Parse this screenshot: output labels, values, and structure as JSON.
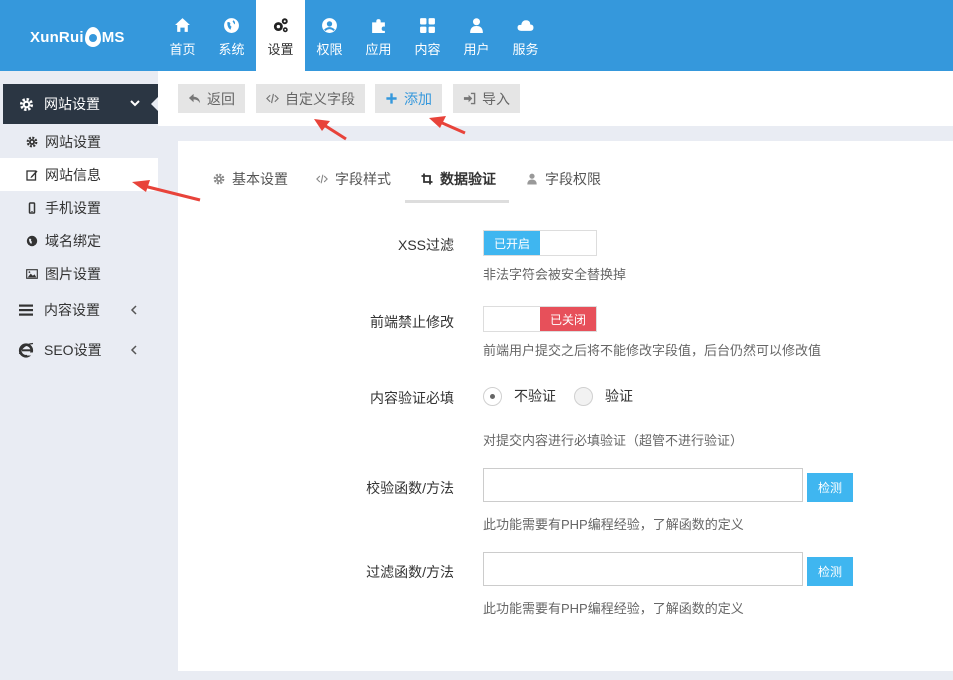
{
  "brand": {
    "logo_prefix": "XunRui",
    "logo_suffix": "MS"
  },
  "nav": {
    "items": [
      {
        "label": "首页",
        "icon": "home-icon"
      },
      {
        "label": "系统",
        "icon": "globe-icon"
      },
      {
        "label": "设置",
        "icon": "gears-icon",
        "active": true
      },
      {
        "label": "权限",
        "icon": "user-circle-icon"
      },
      {
        "label": "应用",
        "icon": "puzzle-icon"
      },
      {
        "label": "内容",
        "icon": "grid-icon"
      },
      {
        "label": "用户",
        "icon": "user-icon"
      },
      {
        "label": "服务",
        "icon": "cloud-icon"
      }
    ]
  },
  "sidebar": {
    "header": "网站设置",
    "sub_items": [
      "网站设置",
      "网站信息",
      "手机设置",
      "域名绑定",
      "图片设置"
    ],
    "groups": [
      "内容设置",
      "SEO设置"
    ]
  },
  "toolbar": {
    "back": "返回",
    "custom_field": "自定义字段",
    "add": "添加",
    "import": "导入"
  },
  "tabs": [
    "基本设置",
    "字段样式",
    "数据验证",
    "字段权限"
  ],
  "form": {
    "xss": {
      "label": "XSS过滤",
      "state": "已开启",
      "help": "非法字符会被安全替换掉"
    },
    "frontend_lock": {
      "label": "前端禁止修改",
      "state": "已关闭",
      "help": "前端用户提交之后将不能修改字段值，后台仍然可以修改值"
    },
    "required": {
      "label": "内容验证必填",
      "option_no": "不验证",
      "option_yes": "验证",
      "help": "对提交内容进行必填验证（超管不进行验证）"
    },
    "validate_fn": {
      "label": "校验函数/方法",
      "value": "",
      "button": "检测",
      "help": "此功能需要有PHP编程经验，了解函数的定义"
    },
    "filter_fn": {
      "label": "过滤函数/方法",
      "value": "",
      "button": "检测",
      "help": "此功能需要有PHP编程经验，了解函数的定义"
    }
  },
  "colors": {
    "primary": "#3598dc",
    "switch_on": "#3fb6f0",
    "switch_off": "#e7505a",
    "sidebar_dark": "#2b3643",
    "annotation": "#e8433a"
  }
}
